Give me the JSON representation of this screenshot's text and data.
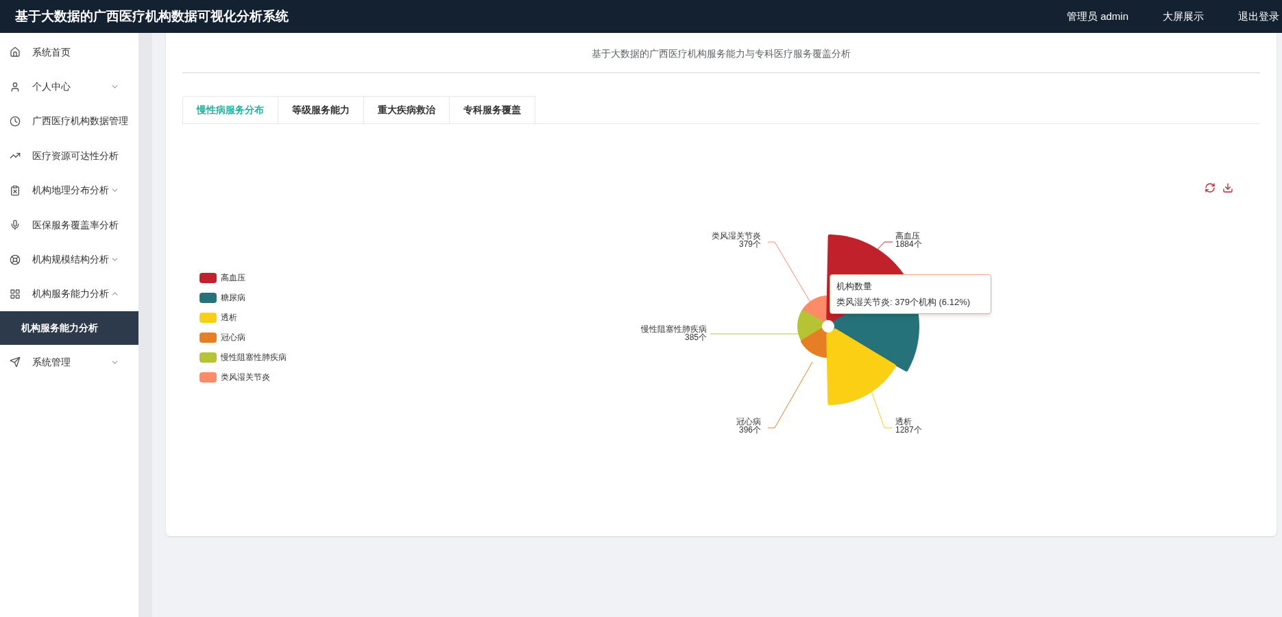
{
  "header": {
    "title": "基于大数据的广西医疗机构数据可视化分析系统",
    "links": [
      "管理员 admin",
      "大屏展示",
      "退出登录"
    ]
  },
  "sidebar": {
    "items": [
      {
        "label": "系统首页"
      },
      {
        "label": "个人中心",
        "expanded": false
      },
      {
        "label": "广西医疗机构数据管理"
      },
      {
        "label": "医疗资源可达性分析"
      },
      {
        "label": "机构地理分布分析",
        "expanded": false
      },
      {
        "label": "医保服务覆盖率分析"
      },
      {
        "label": "机构规模结构分析",
        "expanded": false
      },
      {
        "label": "机构服务能力分析",
        "expanded": true,
        "children": [
          {
            "label": "机构服务能力分析",
            "selected": true
          }
        ]
      },
      {
        "label": "系统管理",
        "expanded": false
      }
    ]
  },
  "card": {
    "heading": "基于大数据的广西医疗机构服务能力与专科医疗服务覆盖分析",
    "tabs": [
      {
        "label": "慢性病服务分布",
        "selected": true
      },
      {
        "label": "等级服务能力",
        "selected": false
      },
      {
        "label": "重大疾病救治",
        "selected": false
      },
      {
        "label": "专科服务覆盖",
        "selected": false
      }
    ],
    "legend": [
      {
        "label": "高血压",
        "color": "#c0212b"
      },
      {
        "label": "糖尿病",
        "color": "#26727a"
      },
      {
        "label": "透析",
        "color": "#fbcf14"
      },
      {
        "label": "冠心病",
        "color": "#e67e26"
      },
      {
        "label": "慢性阻塞性肺疾病",
        "color": "#b5c334"
      },
      {
        "label": "类风湿关节炎",
        "color": "#fd8b68"
      }
    ],
    "rose_slices": [
      {
        "name": "类风湿关节炎",
        "count": "379个",
        "color": "#fd8b68"
      },
      {
        "name": "高血压",
        "count": "1884个",
        "color": "#c0212b"
      },
      {
        "color": "#26727a"
      },
      {
        "name": "慢性阻塞性肺疾病",
        "count": "385个",
        "color": "#b5c334"
      },
      {
        "name": "冠心病",
        "count": "396个",
        "color": "#e67e26"
      },
      {
        "name": "透析",
        "count": "1287个",
        "color": "#fbcf14"
      }
    ],
    "tooltip": {
      "title": "机构数量",
      "text": "类风湿关节炎: 379个机构 (6.12%)"
    }
  }
}
